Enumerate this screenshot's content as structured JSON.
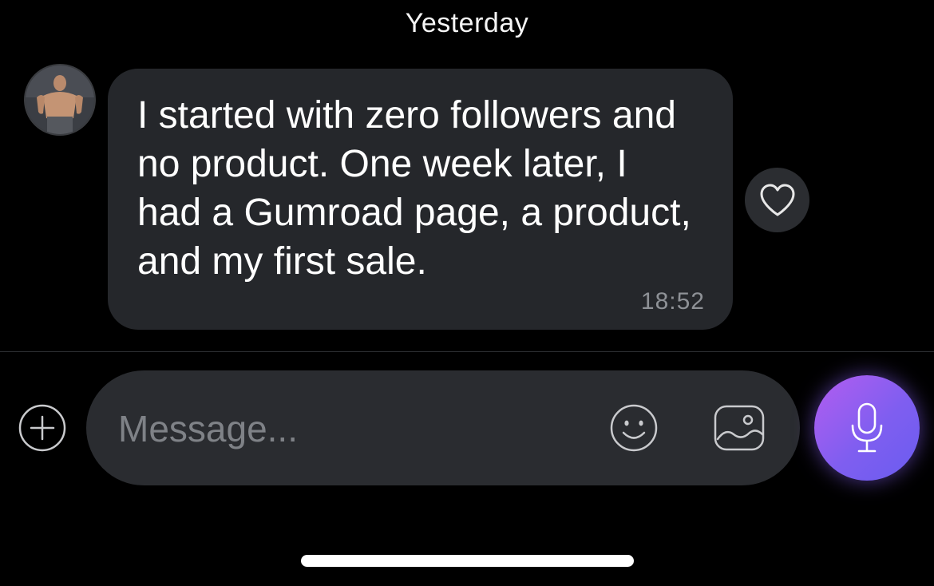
{
  "conversation": {
    "date_separator": "Yesterday"
  },
  "message": {
    "text": "I started with zero followers and no product. One week later, I had a Gumroad page, a product, and my first sale.",
    "time": "18:52",
    "liked": false
  },
  "composer": {
    "placeholder": "Message...",
    "value": ""
  },
  "colors": {
    "background": "#000000",
    "bubble": "#25272b",
    "composer": "#2a2c30",
    "accent_gradient_start": "#b35df0",
    "accent_gradient_end": "#6a5cf0"
  },
  "icons": {
    "avatar": "avatar",
    "like": "heart-icon",
    "add": "plus-circle-icon",
    "emoji": "smiley-icon",
    "image": "image-icon",
    "voice": "microphone-icon"
  }
}
